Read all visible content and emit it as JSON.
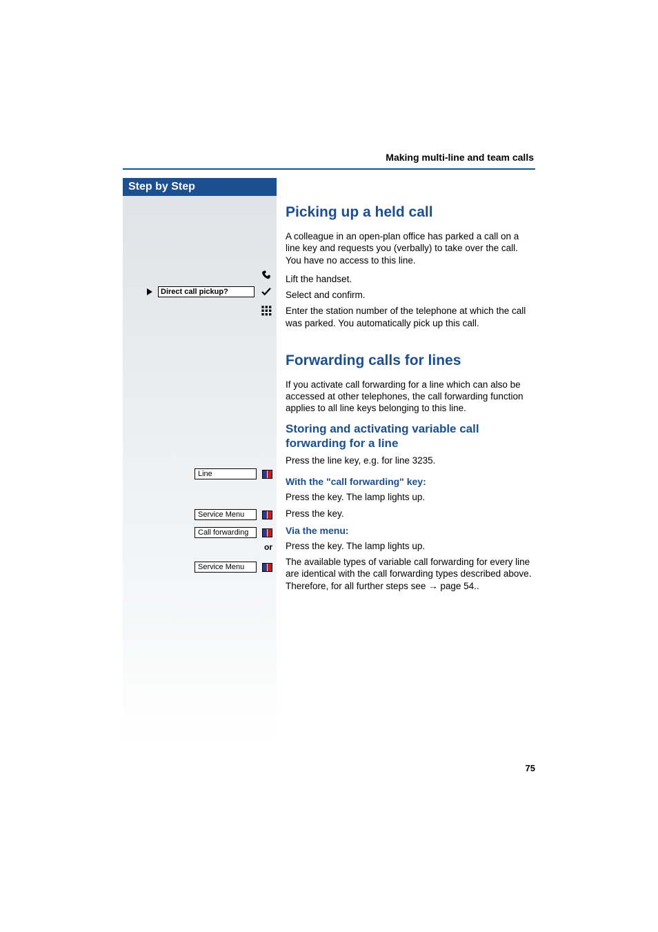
{
  "header": {
    "running": "Making multi-line and team calls",
    "page_number": "75"
  },
  "sidebar": {
    "title": "Step by Step",
    "direct_pickup": "Direct call pickup?",
    "line_key": "Line",
    "service_menu": "Service Menu",
    "call_forwarding": "Call forwarding",
    "or_label": "or"
  },
  "content": {
    "h2_pickup": "Picking up a held call",
    "pickup_intro": "A colleague in an open-plan office has parked a call on a line key and requests you (verbally) to take over the call. You have no access to this line.",
    "lift_handset": "Lift the handset.",
    "select_confirm": "Select and confirm.",
    "enter_station": "Enter the station number of the telephone at which the call was parked. You automatically pick up this call.",
    "h2_forward": "Forwarding calls for lines",
    "forward_intro": "If you activate call forwarding for a line which can also be accessed at other telephones, the call forwarding function applies to all line keys belonging to this line.",
    "h3_store_activate": "Storing and activating variable call forwarding for a line",
    "press_line": "Press the line key, e.g. for line 3235.",
    "h4_with_key": "With the \"call forwarding\" key:",
    "press_key_lamp": "Press the key. The lamp lights up.",
    "press_key": "Press the key.",
    "h4_via_menu": "Via the menu:",
    "available_types": "The available types of variable call forwarding for every line are identical with the call forwarding types described above. Therefore, for all further steps see → page 54.."
  }
}
